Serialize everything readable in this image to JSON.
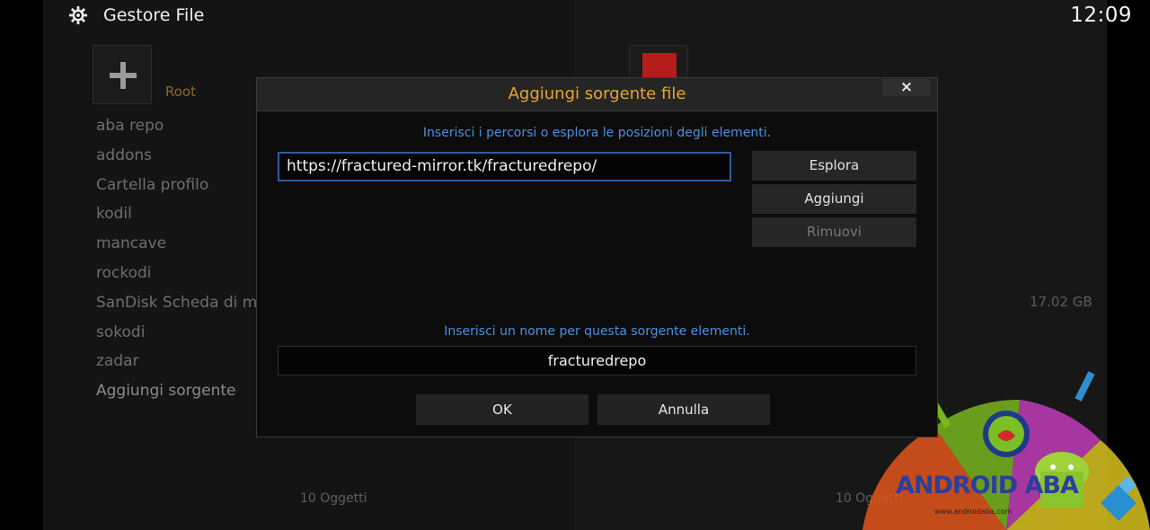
{
  "header": {
    "app_title": "Gestore File",
    "clock": "12:09",
    "icon": "gear-icon"
  },
  "left_pane": {
    "root_label": "Root",
    "sources": [
      "aba repo",
      "addons",
      "Cartella profilo",
      "kodil",
      "mancave",
      "rockodi",
      "SanDisk Scheda di m",
      "sokodi",
      "zadar"
    ],
    "add_source_label": "Aggiungi sorgente",
    "item_count": "10 Oggetti"
  },
  "right_pane": {
    "drive_size": "17.02 GB",
    "item_count": "10 Oggetti"
  },
  "dialog": {
    "title": "Aggiungi sorgente file",
    "close_label": "×",
    "path_hint": "Inserisci i percorsi o esplora le posizioni degli elementi.",
    "path_value": "https://fractured-mirror.tk/fracturedrepo/",
    "browse_label": "Esplora",
    "add_label": "Aggiungi",
    "remove_label": "Rimuovi",
    "name_hint": "Inserisci un nome per questa sorgente elementi.",
    "name_value": "fracturedrepo",
    "ok_label": "OK",
    "cancel_label": "Annulla"
  },
  "watermark": {
    "brand": "ANDROID ABA",
    "url": "www.androidaba.com"
  },
  "colors": {
    "dialog_title": "#e8a52a",
    "hint_text": "#4b90e0",
    "input_focus_border": "#2f5c9c",
    "root_label": "#8a6a1e"
  }
}
